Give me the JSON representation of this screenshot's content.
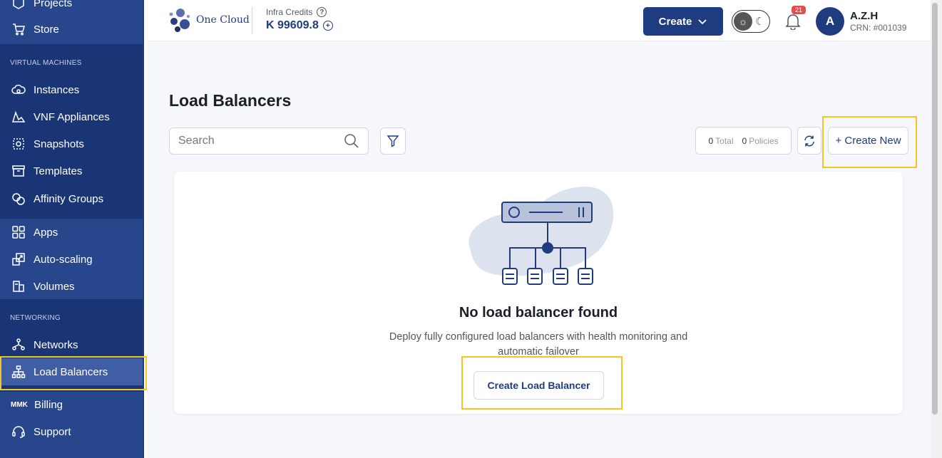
{
  "sidebar": {
    "items_top": [
      {
        "label": "Projects",
        "icon": "hexagon-icon"
      },
      {
        "label": "Store",
        "icon": "cart-icon"
      }
    ],
    "section_vm": "VIRTUAL MACHINES",
    "vm_items": [
      {
        "label": "Instances",
        "icon": "cloud-icon"
      },
      {
        "label": "VNF Appliances",
        "icon": "vnf-icon"
      },
      {
        "label": "Snapshots",
        "icon": "snapshot-icon"
      },
      {
        "label": "Templates",
        "icon": "template-icon"
      },
      {
        "label": "Affinity Groups",
        "icon": "affinity-icon"
      }
    ],
    "app_items": [
      {
        "label": "Apps",
        "icon": "apps-grid-icon"
      },
      {
        "label": "Auto-scaling",
        "icon": "autoscale-icon"
      },
      {
        "label": "Volumes",
        "icon": "volume-icon"
      }
    ],
    "section_net": "NETWORKING",
    "net_items": [
      {
        "label": "Networks",
        "icon": "network-icon"
      },
      {
        "label": "Load Balancers",
        "icon": "load-balancer-icon"
      }
    ],
    "billing": {
      "label": "Billing",
      "prefix": "MMK"
    },
    "support": {
      "label": "Support",
      "icon": "headset-icon"
    }
  },
  "header": {
    "logo_text": "One Cloud",
    "credits_label": "Infra Credits",
    "credits_value": "K 99609.8",
    "create_label": "Create",
    "notification_count": "21",
    "avatar_letter": "A",
    "user_name": "A.Z.H",
    "user_crn": "CRN: #001039"
  },
  "main": {
    "title": "Load Balancers",
    "search_placeholder": "Search",
    "total_count": "0",
    "total_label": "Total",
    "policies_count": "0",
    "policies_label": "Policies",
    "create_new_label": "+ Create New",
    "empty_title": "No load balancer found",
    "empty_desc": "Deploy fully configured load balancers with health monitoring and automatic failover",
    "create_lb_label": "Create Load Balancer"
  },
  "colors": {
    "brand": "#1f3c80",
    "highlight": "#f3c623",
    "badge": "#e74c4c"
  }
}
